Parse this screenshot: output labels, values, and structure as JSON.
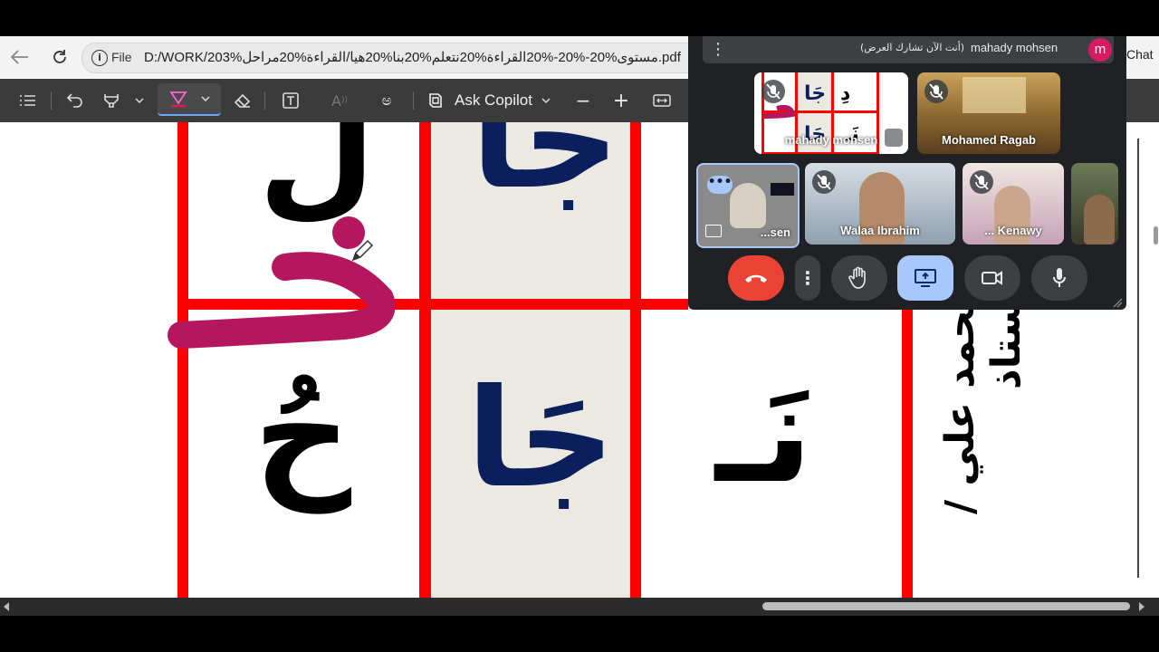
{
  "browser": {
    "back_icon": "back-arrow-icon",
    "refresh_icon": "refresh-icon",
    "address": {
      "scheme_label": "File",
      "url": "D:/WORK/203%مستوى%20-%20-%20القراءة%20نتعلم%20بنا%20هيا/القراءة%20مراحل.pdf"
    },
    "chat_label": "Chat"
  },
  "pdf_toolbar": {
    "items": [
      "contents-icon",
      "undo-icon",
      "highlighter-icon",
      "draw-icon",
      "eraser-icon",
      "text-box-icon",
      "read-aloud-icon",
      "translate-icon"
    ],
    "copilot_label": "Ask Copilot",
    "zoom_out": "−",
    "zoom_in": "+"
  },
  "pdf_content": {
    "grid_letters": {
      "row1": {
        "col1": "لَ",
        "col2": "جَا"
      },
      "row2": {
        "col1": "حُ",
        "col2": "جَا",
        "col3": "نَـ"
      },
      "row3": {
        "col3": "ـ"
      }
    },
    "annotation_letter": "خُ",
    "annotation_color": "#b5175f",
    "teacher_name": "محمد علي  /  أستاذ"
  },
  "meet": {
    "header": {
      "presenter_name": "mahady mohsen",
      "presenting_note": "(أنت الآن تشارك العرض)",
      "avatar_letter": "m",
      "avatar_color": "#d81b60"
    },
    "participants": [
      {
        "name": "mahady mohsen",
        "muted": true
      },
      {
        "name": "Mohamed Ragab",
        "muted": true
      },
      {
        "name": "...sen",
        "muted": false
      },
      {
        "name": "Walaa Ibrahim",
        "muted": true
      },
      {
        "name": "... Kenawy",
        "muted": true
      },
      {
        "name": "",
        "muted": false
      }
    ],
    "controls": [
      "end-call-icon",
      "more-options-icon",
      "raise-hand-icon",
      "present-screen-icon",
      "camera-icon",
      "microphone-icon"
    ],
    "end_call_color": "#ea4335",
    "present_active_color": "#a8c7fa"
  }
}
